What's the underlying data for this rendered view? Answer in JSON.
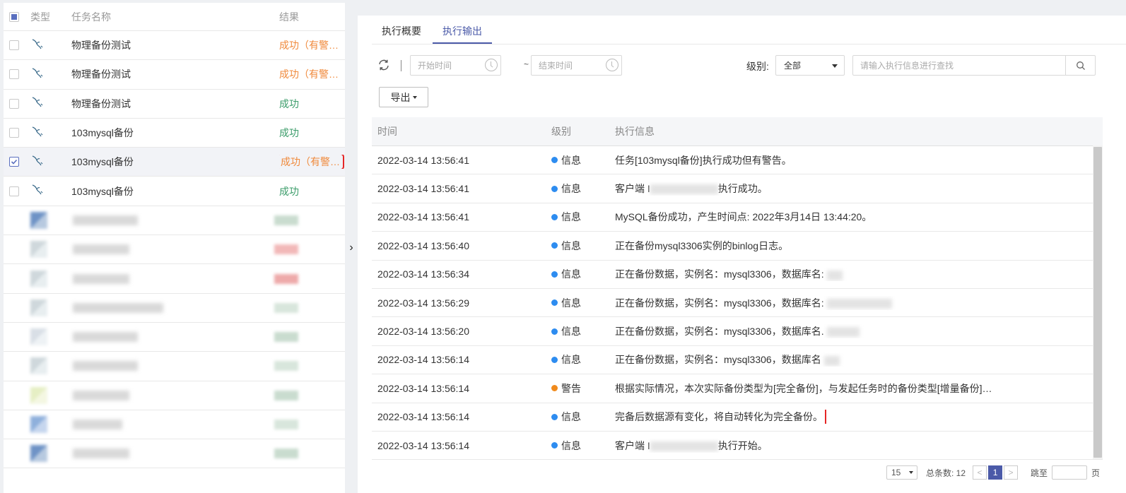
{
  "left_table": {
    "headers": {
      "type": "类型",
      "name": "任务名称",
      "result": "结果"
    },
    "rows": [
      {
        "name": "物理备份测试",
        "result": "成功（有警…",
        "status": "warn",
        "checked": false
      },
      {
        "name": "物理备份测试",
        "result": "成功（有警…",
        "status": "warn",
        "checked": false
      },
      {
        "name": "物理备份测试",
        "result": "成功",
        "status": "ok",
        "checked": false
      },
      {
        "name": "103mysql备份",
        "result": "成功",
        "status": "ok",
        "checked": false
      },
      {
        "name": "103mysql备份",
        "result": "成功（有警…",
        "status": "warn",
        "checked": true
      },
      {
        "name": "103mysql备份",
        "result": "成功",
        "status": "ok",
        "checked": false
      }
    ],
    "blurred_rows": 9
  },
  "tabs": [
    "执行概要",
    "执行输出"
  ],
  "active_tab": 1,
  "toolbar": {
    "start_placeholder": "开始时间",
    "end_placeholder": "结束时间",
    "separator": "~",
    "level_label": "级别:",
    "level_value": "全部",
    "search_placeholder": "请输入执行信息进行查找",
    "export_label": "导出"
  },
  "grid": {
    "headers": {
      "time": "时间",
      "level": "级别",
      "message": "执行信息"
    },
    "rows": [
      {
        "time": "2022-03-14 13:56:41",
        "level": "信息",
        "kind": "info",
        "msg": "任务[103mysql备份]执行成功但有警告。"
      },
      {
        "time": "2022-03-14 13:56:41",
        "level": "信息",
        "kind": "info",
        "msg_pre": "客户端 I",
        "msg_post": "执行成功。"
      },
      {
        "time": "2022-03-14 13:56:41",
        "level": "信息",
        "kind": "info",
        "msg": "MySQL备份成功，产生时间点: 2022年3月14日 13:44:20。"
      },
      {
        "time": "2022-03-14 13:56:40",
        "level": "信息",
        "kind": "info",
        "msg": "正在备份mysql3306实例的binlog日志。"
      },
      {
        "time": "2022-03-14 13:56:34",
        "level": "信息",
        "kind": "info",
        "msg": "正在备份数据，实例名：mysql3306，数据库名:"
      },
      {
        "time": "2022-03-14 13:56:29",
        "level": "信息",
        "kind": "info",
        "msg": "正在备份数据，实例名：mysql3306，数据库名:"
      },
      {
        "time": "2022-03-14 13:56:20",
        "level": "信息",
        "kind": "info",
        "msg": "正在备份数据，实例名：mysql3306，数据库名."
      },
      {
        "time": "2022-03-14 13:56:14",
        "level": "信息",
        "kind": "info",
        "msg": "正在备份数据，实例名：mysql3306，数据库名"
      },
      {
        "time": "2022-03-14 13:56:14",
        "level": "警告",
        "kind": "warn",
        "msg": "根据实际情况，本次实际备份类型为[完全备份]，与发起任务时的备份类型[增量备份]…"
      },
      {
        "time": "2022-03-14 13:56:14",
        "level": "信息",
        "kind": "info",
        "msg": "完备后数据源有变化，将自动转化为完全备份。"
      },
      {
        "time": "2022-03-14 13:56:14",
        "level": "信息",
        "kind": "info",
        "msg_pre": "客户端 I",
        "msg_post": "执行开始。"
      }
    ]
  },
  "pager": {
    "page_size": "15",
    "total_label": "总条数: 12",
    "prev": "<",
    "current": "1",
    "next": ">",
    "jump_label": "跳至",
    "page_unit": "页"
  },
  "colors": {
    "accent": "#4b5aa8",
    "ok": "#3b9c6a",
    "warn": "#f08a3c",
    "info_dot": "#2d8cf0",
    "highlight": "#e52626"
  }
}
